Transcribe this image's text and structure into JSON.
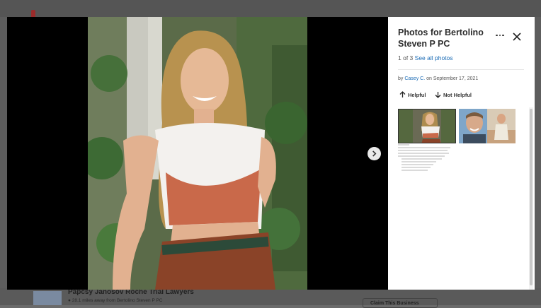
{
  "background": {
    "business_name": "Papcsy Janosov Roche Trial Lawyers",
    "distance_text": "28.1 miles away from Bertolino Steven P PC",
    "claim_button": "Claim This Business"
  },
  "modal": {
    "title": "Photos for Bertolino Steven P PC",
    "counter": "1 of 3",
    "see_all_label": "See all photos",
    "byline_prefix": "by",
    "author": "Casey C.",
    "date_text": "on September 17, 2021",
    "helpful_label": "Helpful",
    "not_helpful_label": "Not Helpful",
    "icons": {
      "more": "more-options-icon",
      "close": "close-icon",
      "next": "chevron-right-icon",
      "helpful": "arrow-up-icon",
      "not_helpful": "arrow-down-icon"
    },
    "thumbnail_count": 3
  },
  "colors": {
    "link": "#1a6bb5",
    "overlay": "#5d5d5d",
    "modal_bg": "#000000",
    "panel_bg": "#ffffff"
  }
}
